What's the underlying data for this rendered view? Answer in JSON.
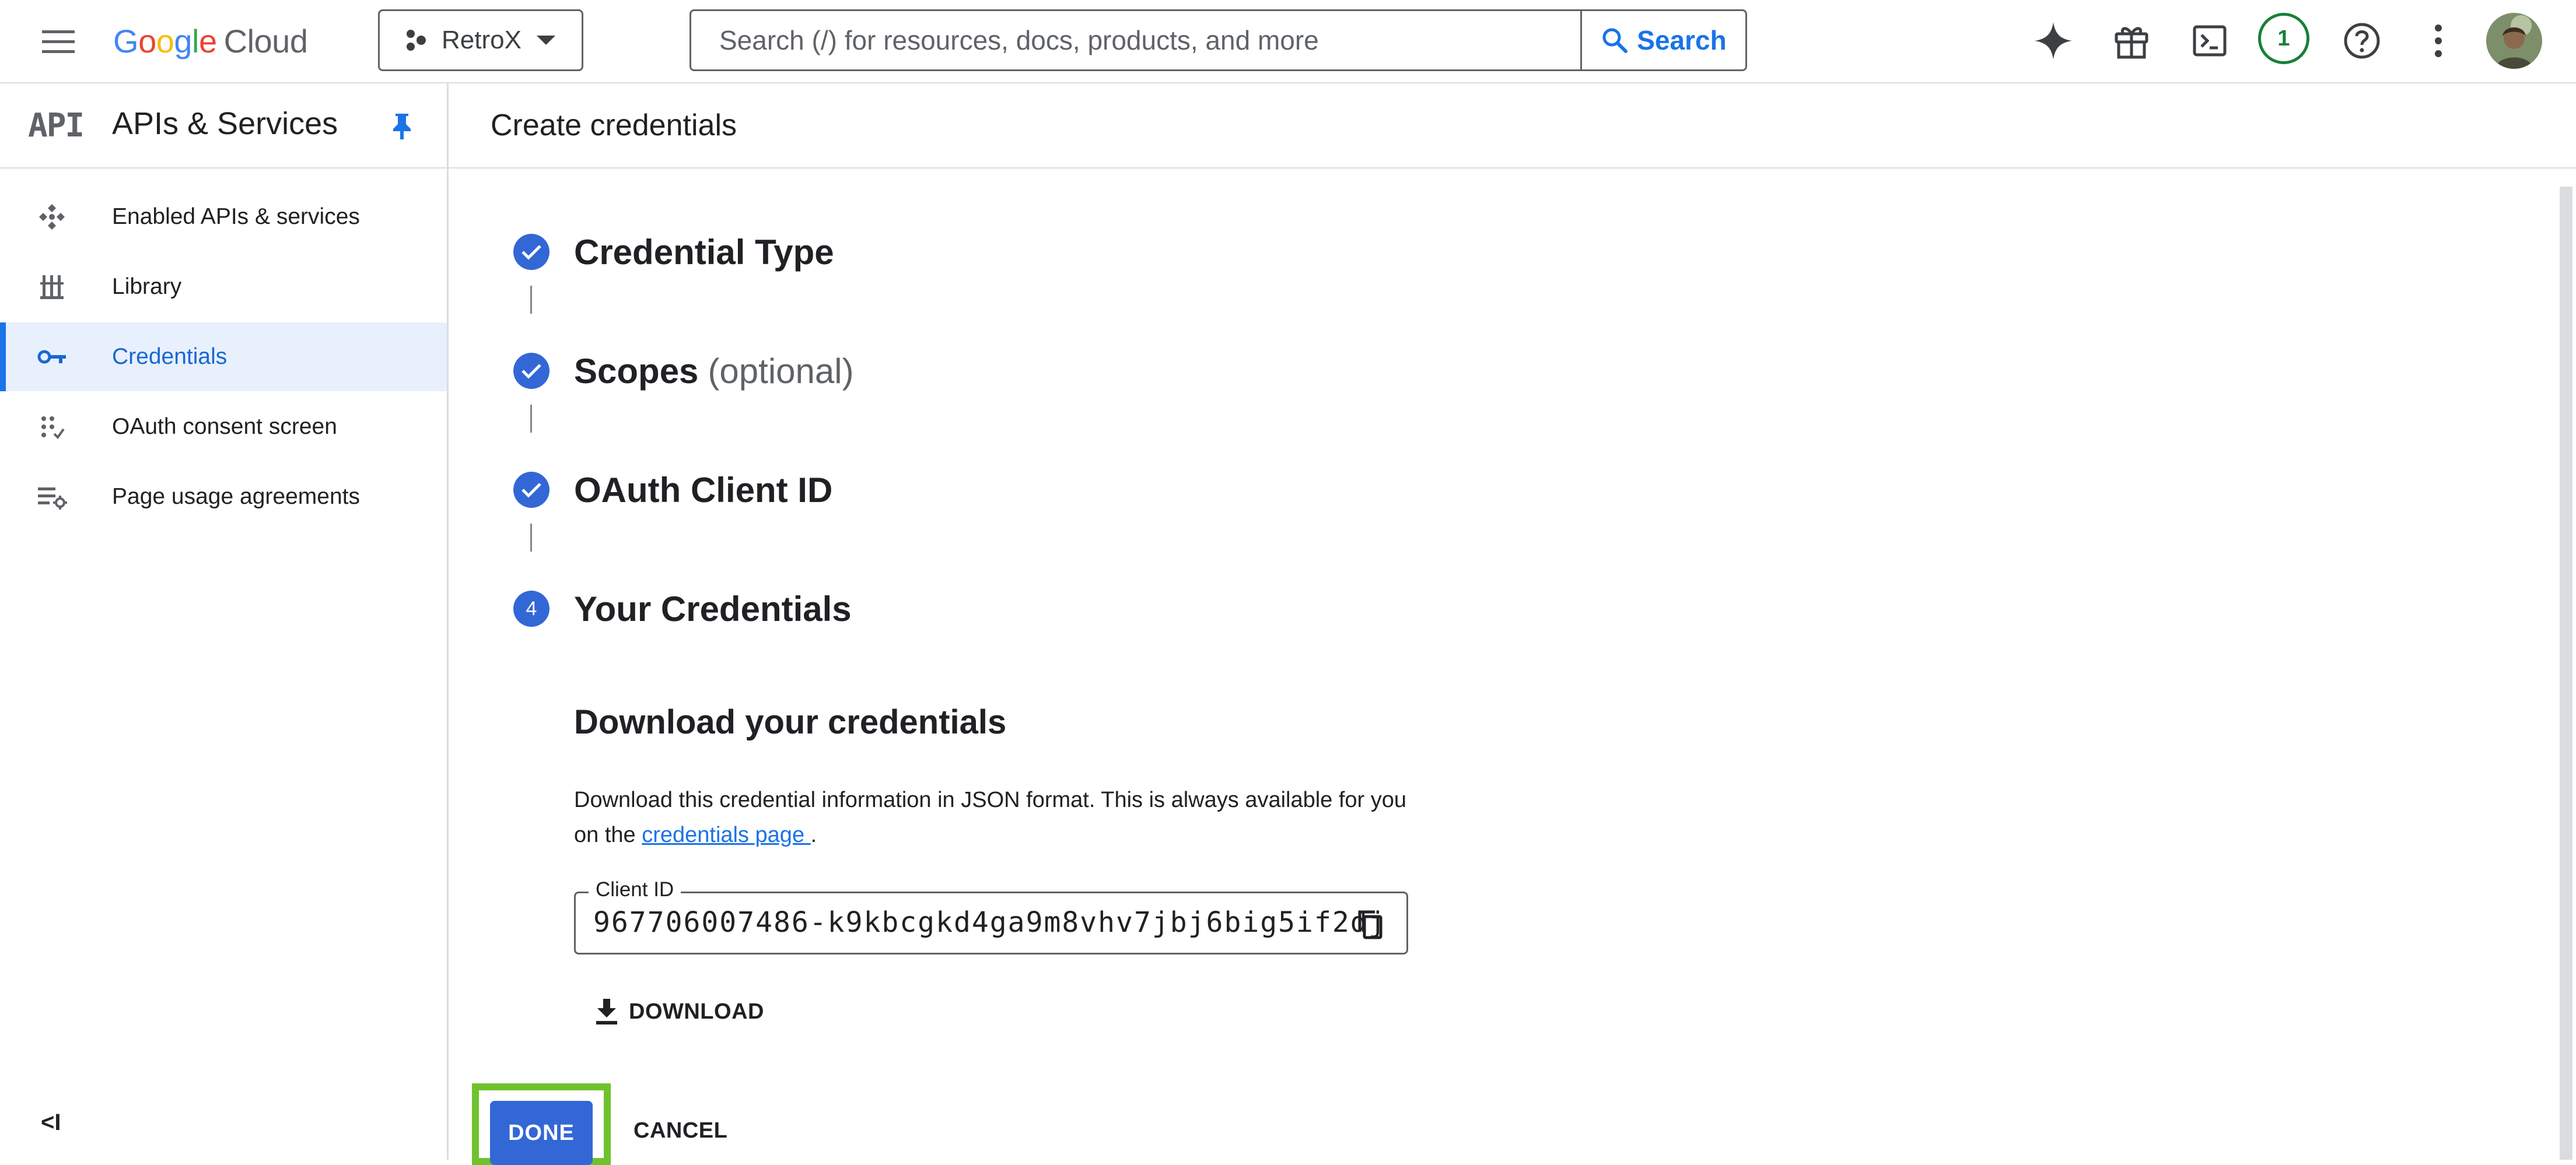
{
  "topbar": {
    "menu_icon": "hamburger-menu-icon",
    "logo": {
      "g1": "G",
      "o1": "o",
      "o2": "o",
      "g2": "g",
      "l": "l",
      "e": "e",
      "cloud": "Cloud"
    },
    "project": "RetroX",
    "search": {
      "placeholder": "Search (/) for resources, docs, products, and more",
      "button_label": "Search"
    },
    "icons": [
      "gemini-spark-icon",
      "gift-icon",
      "cloud-shell-icon",
      "help-icon",
      "more-vert-icon"
    ],
    "notification_count": "1"
  },
  "sidebar": {
    "logo_text": "API",
    "title": "APIs & Services",
    "items": [
      {
        "label": "Enabled APIs & services",
        "icon": "enabled-apis-icon",
        "active": false
      },
      {
        "label": "Library",
        "icon": "library-icon",
        "active": false
      },
      {
        "label": "Credentials",
        "icon": "key-icon",
        "active": true
      },
      {
        "label": "OAuth consent screen",
        "icon": "oauth-consent-icon",
        "active": false
      },
      {
        "label": "Page usage agreements",
        "icon": "page-usage-icon",
        "active": false
      }
    ],
    "collapse_label": "<I"
  },
  "main": {
    "page_title": "Create credentials",
    "steps": [
      {
        "title": "Credential Type",
        "optional": "",
        "status": "complete"
      },
      {
        "title": "Scopes",
        "optional": "(optional)",
        "status": "complete"
      },
      {
        "title": "OAuth Client ID",
        "optional": "",
        "status": "complete"
      },
      {
        "title": "Your Credentials",
        "optional": "",
        "status": "current",
        "number": "4"
      }
    ],
    "download": {
      "heading": "Download your credentials",
      "description_before": "Download this credential information in JSON format. This is always available for you on the ",
      "link_text": "credentials page ",
      "description_after": ".",
      "client_id_label": "Client ID",
      "client_id_value": "967706007486-k9kbcgkd4ga9m8vhv7jbj6big5if2dj",
      "download_label": "DOWNLOAD"
    },
    "actions": {
      "done_label": "DONE",
      "cancel_label": "CANCEL"
    }
  },
  "colors": {
    "primary": "#3367d6",
    "link": "#1a73e8",
    "highlight": "#6fc22e",
    "active_bg": "#e8f0fe",
    "badge_green": "#188038"
  }
}
